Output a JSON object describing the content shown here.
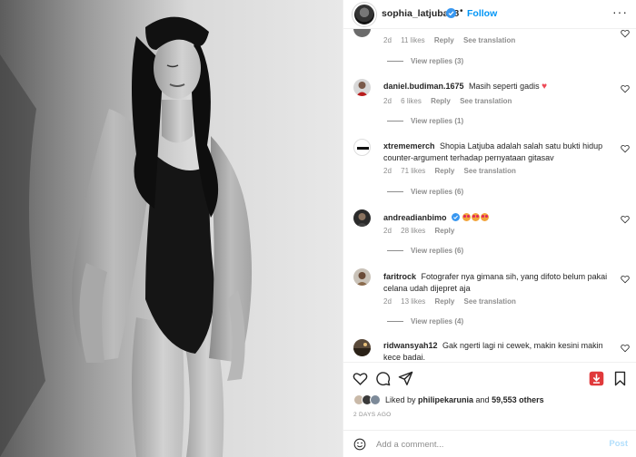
{
  "header": {
    "username": "sophia_latjuba88",
    "separator": "•",
    "follow_label": "Follow",
    "more_label": "···"
  },
  "comments": [
    {
      "username": "",
      "text": "",
      "age": "2d",
      "likes": "11 likes",
      "reply": "Reply",
      "translation": "See translation",
      "view_replies": "View replies (3)"
    },
    {
      "username": "daniel.budiman.1675",
      "text": "Masih seperti gadis",
      "age": "2d",
      "likes": "6 likes",
      "reply": "Reply",
      "translation": "See translation",
      "view_replies": "View replies (1)"
    },
    {
      "username": "xtrememerch",
      "text": "Shopia Latjuba adalah salah satu bukti hidup counter-argument terhadap pernyataan gitasav",
      "age": "2d",
      "likes": "71 likes",
      "reply": "Reply",
      "translation": "See translation",
      "view_replies": "View replies (6)"
    },
    {
      "username": "andreadianbimo",
      "text": "",
      "age": "2d",
      "likes": "28 likes",
      "reply": "Reply",
      "translation": "",
      "view_replies": "View replies (6)"
    },
    {
      "username": "faritrock",
      "text": "Fotografer nya gimana sih, yang difoto belum pakai celana udah dijepret aja",
      "age": "2d",
      "likes": "13 likes",
      "reply": "Reply",
      "translation": "See translation",
      "view_replies": "View replies (4)"
    },
    {
      "username": "ridwansyah12",
      "text": "Gak ngerti lagi ni cewek, makin kesini makin kece badai.",
      "age": "",
      "likes": "",
      "reply": "",
      "translation": "",
      "view_replies": ""
    }
  ],
  "likes": {
    "prefix": "Liked by ",
    "first_user": "philipekarunia",
    "middle": " and ",
    "count": "59,553 others"
  },
  "date": "2 DAYS AGO",
  "add_comment": {
    "placeholder": "Add a comment...",
    "post_label": "Post"
  },
  "icons": [
    "heart-icon",
    "comment-icon",
    "share-icon",
    "download-icon",
    "bookmark-icon",
    "emoji-icon",
    "verified-icon"
  ],
  "colors": {
    "accent": "#0095f6",
    "like_red": "#ed4956",
    "download_red": "#e0393b",
    "muted": "#8e8e8e",
    "post_disabled": "#b2dffc"
  }
}
